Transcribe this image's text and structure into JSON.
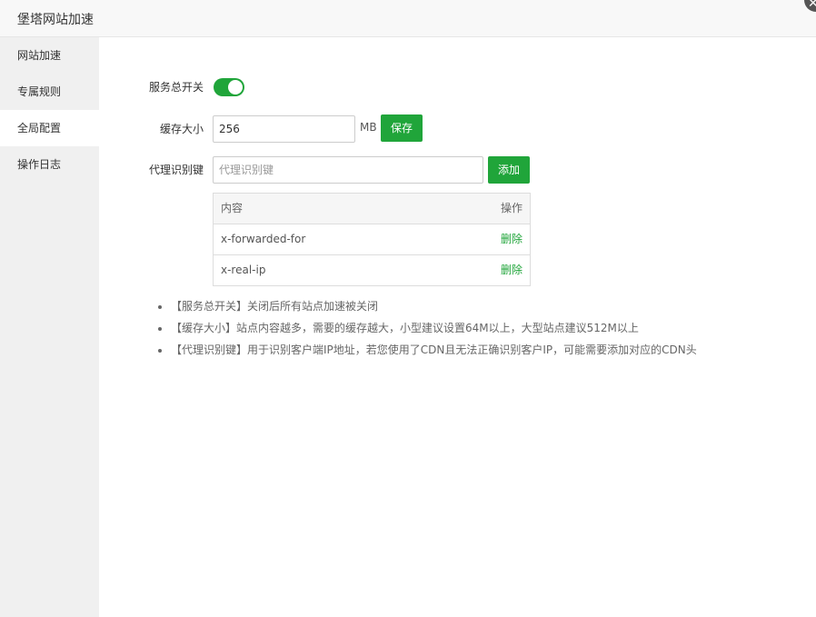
{
  "window": {
    "title": "堡塔网站加速",
    "close_glyph": "✕"
  },
  "sidebar": {
    "items": [
      {
        "label": "网站加速",
        "active": false
      },
      {
        "label": "专属规则",
        "active": false
      },
      {
        "label": "全局配置",
        "active": true
      },
      {
        "label": "操作日志",
        "active": false
      }
    ]
  },
  "form": {
    "service_switch": {
      "label": "服务总开关",
      "enabled": true
    },
    "cache_size": {
      "label": "缓存大小",
      "value": "256",
      "unit": "MB",
      "save_label": "保存"
    },
    "proxy_key": {
      "label": "代理识别键",
      "placeholder": "代理识别键",
      "add_label": "添加"
    }
  },
  "table": {
    "columns": [
      "内容",
      "操作"
    ],
    "rows": [
      {
        "content": "x-forwarded-for",
        "action": "删除"
      },
      {
        "content": "x-real-ip",
        "action": "删除"
      }
    ]
  },
  "tips": [
    "【服务总开关】关闭后所有站点加速被关闭",
    "【缓存大小】站点内容越多，需要的缓存越大，小型建议设置64M以上，大型站点建议512M以上",
    "【代理识别键】用于识别客户端IP地址，若您使用了CDN且无法正确识别客户IP，可能需要添加对应的CDN头"
  ],
  "colors": {
    "accent": "#20a53a",
    "sidebar_bg": "#f0f0f0",
    "titlebar_bg": "#f8f8f8"
  }
}
